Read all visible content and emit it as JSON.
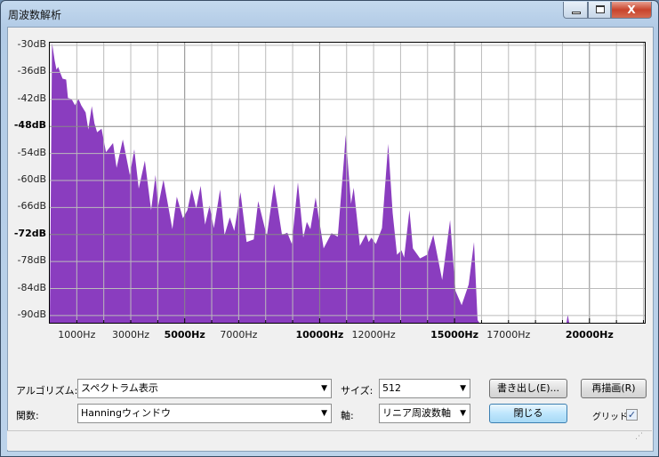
{
  "window": {
    "title": "周波数解析",
    "minimize": "minimize",
    "maximize": "maximize",
    "close": "X"
  },
  "controls": {
    "algorithm_label": "アルゴリズム:",
    "algorithm_value": "スペクトラム表示",
    "size_label": "サイズ:",
    "size_value": "512",
    "function_label": "関数:",
    "function_value": "Hanningウィンドウ",
    "axis_label": "軸:",
    "axis_value": "リニア周波数軸",
    "export_button": "書き出し(E)...",
    "redraw_button": "再描画(R)",
    "close_button": "閉じる",
    "grid_label": "グリッド",
    "grid_checked": true
  },
  "chart_data": {
    "type": "area",
    "color": "#8a3dbf",
    "xlim": [
      0,
      22050
    ],
    "ylim": [
      -91.6,
      -29.4
    ],
    "grid": true,
    "y_ticks": [
      {
        "v": -30,
        "label": "-30dB"
      },
      {
        "v": -36,
        "label": "-36dB"
      },
      {
        "v": -42,
        "label": "-42dB"
      },
      {
        "v": -48,
        "label": "-48dB",
        "bold": true
      },
      {
        "v": -54,
        "label": "-54dB"
      },
      {
        "v": -60,
        "label": "-60dB"
      },
      {
        "v": -66,
        "label": "-66dB"
      },
      {
        "v": -72,
        "label": "-72dB",
        "bold": true
      },
      {
        "v": -78,
        "label": "-78dB"
      },
      {
        "v": -84,
        "label": "-84dB"
      },
      {
        "v": -90,
        "label": "-90dB"
      }
    ],
    "x_ticks": [
      {
        "v": 1000,
        "label": "1000Hz"
      },
      {
        "v": 3000,
        "label": "3000Hz"
      },
      {
        "v": 5000,
        "label": "5000Hz",
        "bold": true
      },
      {
        "v": 7000,
        "label": "7000Hz"
      },
      {
        "v": 10000,
        "label": "10000Hz",
        "bold": true
      },
      {
        "v": 12000,
        "label": "12000Hz"
      },
      {
        "v": 15000,
        "label": "15000Hz",
        "bold": true
      },
      {
        "v": 17000,
        "label": "17000Hz"
      },
      {
        "v": 20000,
        "label": "20000Hz",
        "bold": true
      }
    ],
    "points": [
      [
        82,
        -29
      ],
      [
        180,
        -33.4
      ],
      [
        246,
        -35.4
      ],
      [
        311,
        -34.8
      ],
      [
        410,
        -36.4
      ],
      [
        475,
        -37.4
      ],
      [
        607,
        -37.6
      ],
      [
        672,
        -41.7
      ],
      [
        803,
        -41.9
      ],
      [
        934,
        -43.3
      ],
      [
        1066,
        -41.9
      ],
      [
        1164,
        -43.3
      ],
      [
        1328,
        -44.9
      ],
      [
        1426,
        -48.7
      ],
      [
        1557,
        -43.5
      ],
      [
        1656,
        -47.3
      ],
      [
        1754,
        -49.3
      ],
      [
        1918,
        -48.5
      ],
      [
        2016,
        -51.7
      ],
      [
        2082,
        -53.7
      ],
      [
        2344,
        -51.7
      ],
      [
        2475,
        -57.2
      ],
      [
        2705,
        -50.9
      ],
      [
        2967,
        -58.8
      ],
      [
        3131,
        -53.1
      ],
      [
        3295,
        -61.8
      ],
      [
        3525,
        -55.6
      ],
      [
        3754,
        -66.6
      ],
      [
        3918,
        -58.8
      ],
      [
        4016,
        -65.8
      ],
      [
        4213,
        -59.8
      ],
      [
        4541,
        -70.8
      ],
      [
        4705,
        -63.6
      ],
      [
        4934,
        -68.4
      ],
      [
        5098,
        -66.6
      ],
      [
        5262,
        -62.0
      ],
      [
        5426,
        -66.2
      ],
      [
        5590,
        -61.2
      ],
      [
        5754,
        -69.8
      ],
      [
        5918,
        -65.6
      ],
      [
        6082,
        -70.6
      ],
      [
        6311,
        -62.0
      ],
      [
        6475,
        -72.1
      ],
      [
        6672,
        -68.2
      ],
      [
        6836,
        -71.2
      ],
      [
        7066,
        -62.6
      ],
      [
        7295,
        -73.7
      ],
      [
        7557,
        -73.1
      ],
      [
        7721,
        -64.6
      ],
      [
        8016,
        -71.7
      ],
      [
        8049,
        -72.1
      ],
      [
        8311,
        -60.8
      ],
      [
        8607,
        -72.1
      ],
      [
        8803,
        -71.6
      ],
      [
        8967,
        -74.1
      ],
      [
        9197,
        -60.4
      ],
      [
        9393,
        -72.7
      ],
      [
        9525,
        -69.2
      ],
      [
        9656,
        -70.8
      ],
      [
        9852,
        -63.8
      ],
      [
        10148,
        -75.1
      ],
      [
        10443,
        -71.7
      ],
      [
        10672,
        -72.5
      ],
      [
        10902,
        -55.2
      ],
      [
        10967,
        -49.9
      ],
      [
        11164,
        -65.2
      ],
      [
        11262,
        -61.6
      ],
      [
        11492,
        -74.5
      ],
      [
        11721,
        -71.9
      ],
      [
        11820,
        -73.7
      ],
      [
        11918,
        -72.7
      ],
      [
        12082,
        -74.1
      ],
      [
        12311,
        -70.6
      ],
      [
        12541,
        -51.9
      ],
      [
        12705,
        -67.2
      ],
      [
        12869,
        -76.5
      ],
      [
        13033,
        -75.5
      ],
      [
        13131,
        -77.1
      ],
      [
        13328,
        -66.6
      ],
      [
        13459,
        -75.1
      ],
      [
        13721,
        -77.3
      ],
      [
        13984,
        -76.5
      ],
      [
        14213,
        -72.1
      ],
      [
        14541,
        -82.1
      ],
      [
        14836,
        -68.8
      ],
      [
        15033,
        -84.5
      ],
      [
        15262,
        -87.7
      ],
      [
        15525,
        -83.1
      ],
      [
        15721,
        -73.7
      ],
      [
        15852,
        -91.0
      ],
      [
        15918,
        -91.6
      ],
      [
        19150,
        -91.6
      ],
      [
        19197,
        -89.8
      ],
      [
        19250,
        -91.6
      ]
    ]
  }
}
